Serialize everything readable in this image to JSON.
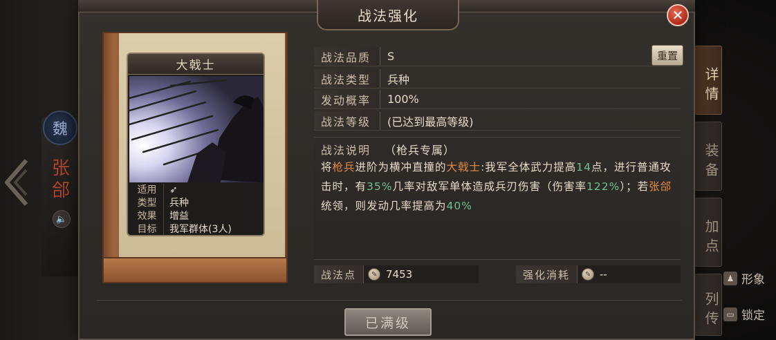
{
  "background": {
    "faction_char": "魏",
    "general_name": "张郃"
  },
  "dialog": {
    "title": "战法强化",
    "close_glyph": "✕"
  },
  "card": {
    "name": "大戟士",
    "info": [
      {
        "key": "适用",
        "value": ""
      },
      {
        "key": "类型",
        "value": "兵种"
      },
      {
        "key": "效果",
        "value": "增益"
      },
      {
        "key": "目标",
        "value": "我军群体(3人)"
      }
    ]
  },
  "details": {
    "quality_label": "战法品质",
    "quality_value": "S",
    "type_label": "战法类型",
    "type_value": "兵种",
    "rate_label": "发动概率",
    "rate_value": "100%",
    "level_label": "战法等级",
    "level_value": "(已达到最高等级)",
    "reset_label": "重置"
  },
  "description": {
    "label": "战法说明",
    "sub": "（枪兵专属）",
    "segments": [
      {
        "t": "将",
        "c": ""
      },
      {
        "t": "枪兵",
        "c": "orange"
      },
      {
        "t": "进阶为横冲直撞的",
        "c": ""
      },
      {
        "t": "大戟士",
        "c": "orange"
      },
      {
        "t": ":我军全体武力提高",
        "c": ""
      },
      {
        "t": "14",
        "c": "green"
      },
      {
        "t": "点，进行普通攻击时，有",
        "c": ""
      },
      {
        "t": "35%",
        "c": "green"
      },
      {
        "t": "几率对敌军单体造成兵刃伤害（伤害率",
        "c": ""
      },
      {
        "t": "122%",
        "c": "green"
      },
      {
        "t": "）；若",
        "c": ""
      },
      {
        "t": "张郃",
        "c": "orange"
      },
      {
        "t": "统领，则发动几率提高为",
        "c": ""
      },
      {
        "t": "40%",
        "c": "green"
      }
    ]
  },
  "points": {
    "label": "战法点",
    "value": "7453",
    "cost_label": "强化消耗",
    "cost_value": "--"
  },
  "action": {
    "button": "已满级"
  },
  "side_tabs": [
    {
      "label": "详情",
      "active": true
    },
    {
      "label": "装备",
      "active": false
    },
    {
      "label": "加点",
      "active": false
    },
    {
      "label": "列传",
      "active": false
    }
  ],
  "right_extras": {
    "image_label": "形象",
    "lock_label": "锁定"
  },
  "colors": {
    "highlight_orange": "#e68a3d",
    "highlight_green": "#6dc28e",
    "close_red": "#b0291b"
  }
}
